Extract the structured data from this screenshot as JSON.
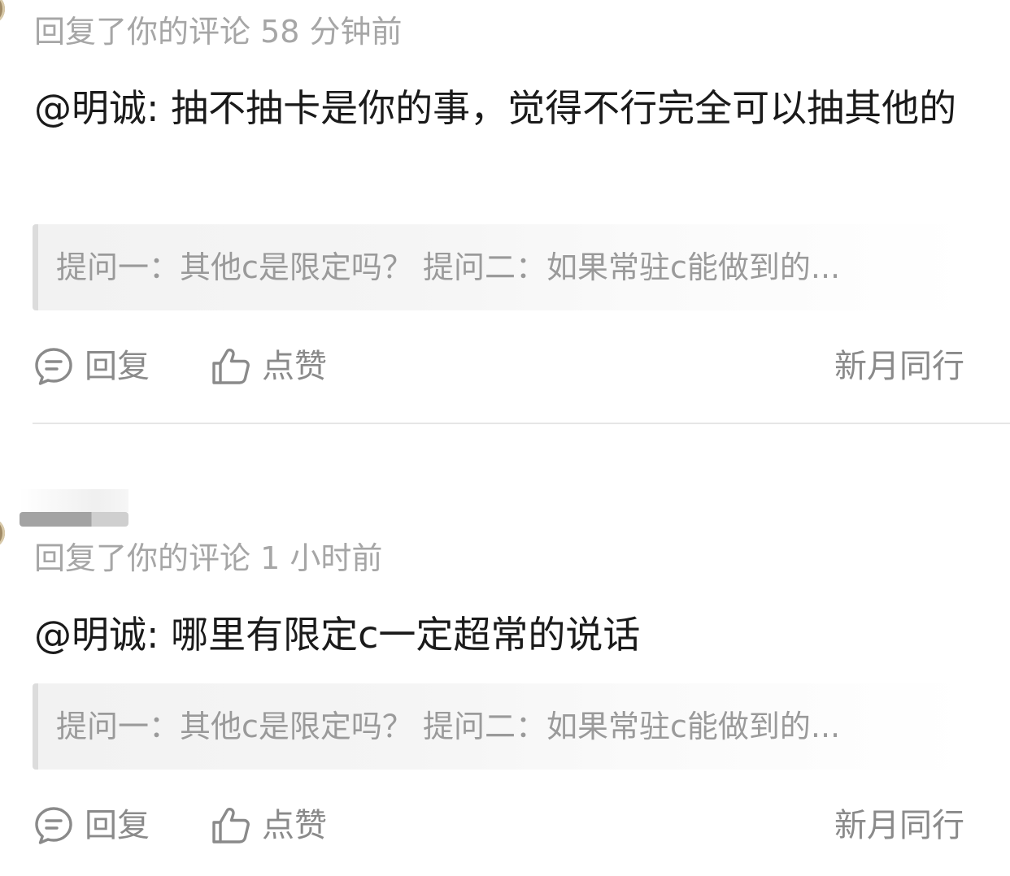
{
  "notifications": [
    {
      "meta": "回复了你的评论 58 分钟前",
      "comment": "@明诚: 抽不抽卡是你的事，觉得不行完全可以抽其他的",
      "quote": "提问一：其他c是限定吗？ 提问二：如果常驻c能做到的...",
      "actions": {
        "reply": "回复",
        "like": "点赞"
      },
      "source": "新月同行"
    },
    {
      "meta": "回复了你的评论 1 小时前",
      "comment": "@明诚: 哪里有限定c一定超常的说话",
      "quote": "提问一：其他c是限定吗？ 提问二：如果常驻c能做到的...",
      "actions": {
        "reply": "回复",
        "like": "点赞"
      },
      "source": "新月同行"
    }
  ],
  "icons": {
    "reply": "comment-bubble-icon",
    "like": "thumbs-up-icon"
  },
  "colors": {
    "meta_text": "#a6a6a6",
    "body_text": "#1a1a1a",
    "action_text": "#8a8a8a",
    "quote_bar": "#dcdcdc",
    "divider": "#e6e6e6"
  }
}
